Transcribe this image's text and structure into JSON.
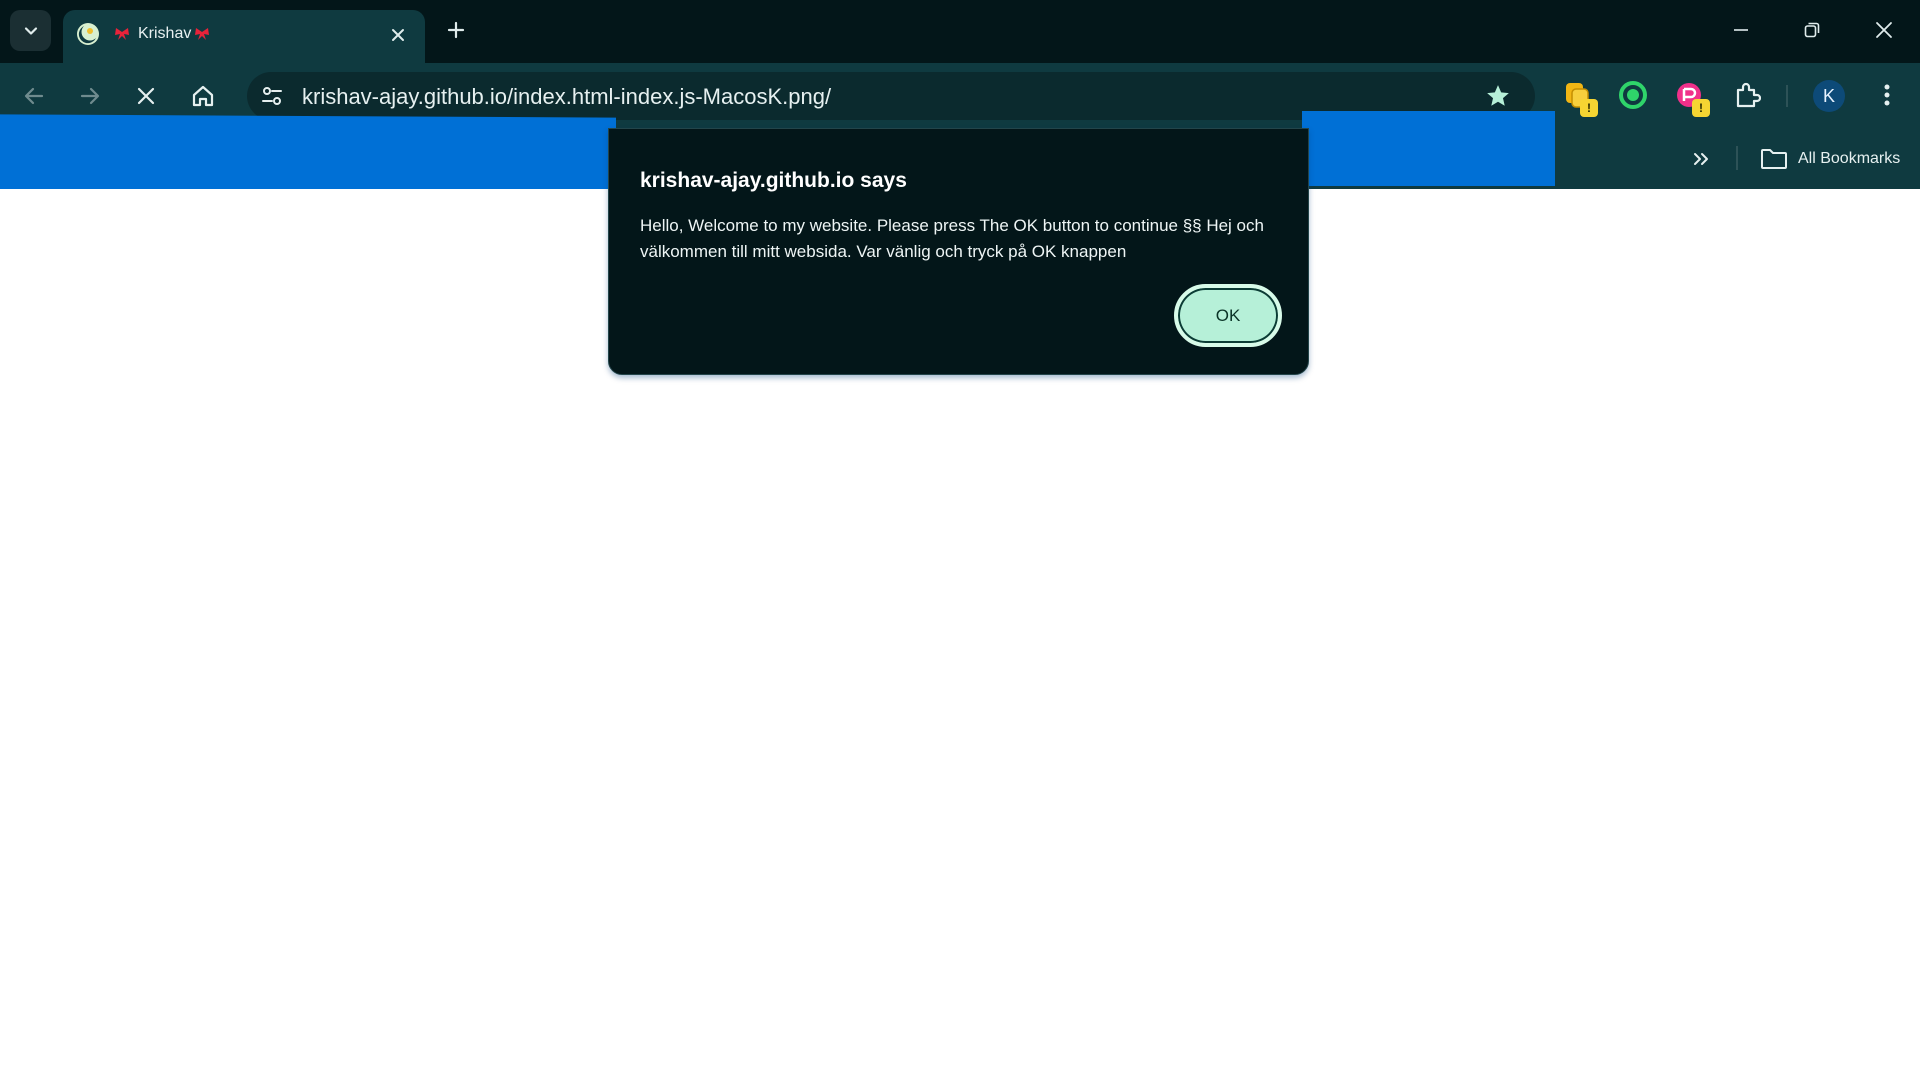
{
  "browser": {
    "tab": {
      "title": "Krishav",
      "favicon_icon": "site-favicon-icon"
    },
    "address_bar": {
      "url": "krishav-ajay.github.io/index.html-index.js-MacosK.png/"
    },
    "profile": {
      "initial": "K"
    },
    "bookmarks_bar": {
      "all_bookmarks_label": "All Bookmarks"
    }
  },
  "dialog": {
    "heading": "krishav-ajay.github.io says",
    "message": "Hello, Welcome to my website. Please press The OK button to continue §§ Hej och välkommen till mitt websida. Var vänlig och tryck på OK knappen",
    "ok_label": "OK"
  },
  "colors": {
    "chrome_dark": "#031619",
    "toolbar": "#0f3a40",
    "redaction_blue": "#0070d6",
    "ok_button": "#b6f0d8",
    "extension_badge": "#f6d532"
  }
}
